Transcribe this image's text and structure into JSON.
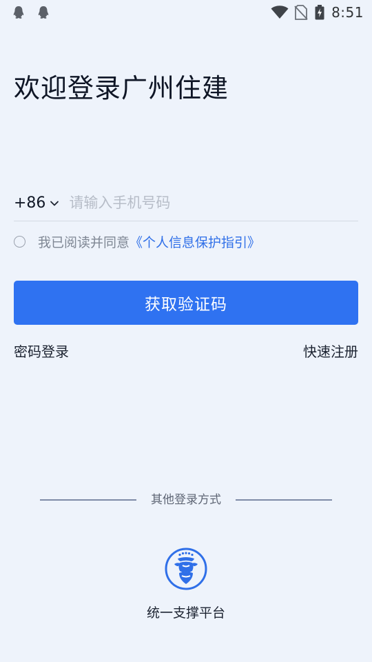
{
  "status_bar": {
    "time": "8:51",
    "icons": [
      "qq-icon",
      "qq-icon",
      "wifi-icon",
      "no-sim-icon",
      "battery-charging-icon"
    ]
  },
  "title": "欢迎登录广州住建",
  "phone": {
    "country_code": "+86",
    "placeholder": "请输入手机号码",
    "value": ""
  },
  "agreement": {
    "checked": false,
    "prefix": "我已阅读并同意",
    "link": "《个人信息保护指引》"
  },
  "primary_button": "获取验证码",
  "links": {
    "password_login": "密码登录",
    "quick_register": "快速注册"
  },
  "other_login": {
    "divider": "其他登录方式",
    "items": [
      {
        "label": "统一支撑平台",
        "icon": "unified-platform-logo-icon"
      }
    ]
  },
  "colors": {
    "background": "#eef3fb",
    "primary": "#2f72f1",
    "link": "#2f6fe8",
    "placeholder": "#b7bdc8",
    "muted_text": "#7f8794"
  }
}
